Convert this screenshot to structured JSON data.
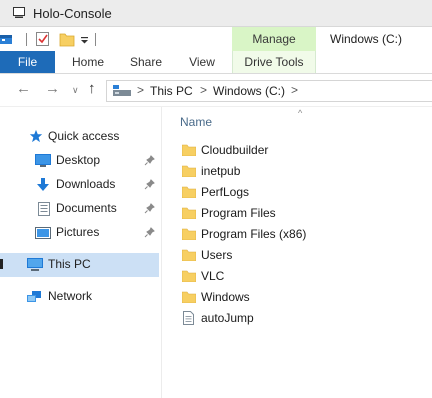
{
  "window": {
    "title": "Holo-Console"
  },
  "quick_access_toolbar": {
    "items": [
      "properties-icon",
      "checkmark-icon",
      "new-folder-icon",
      "customize-dropdown-icon"
    ]
  },
  "ribbon": {
    "contextual_group": "Manage",
    "location_title": "Windows (C:)",
    "tabs": [
      "File",
      "Home",
      "Share",
      "View",
      "Drive Tools"
    ]
  },
  "address_bar": {
    "crumbs": [
      "This PC",
      "Windows (C:)"
    ],
    "separator": ">"
  },
  "nav_pane": {
    "items": [
      {
        "label": "Quick access",
        "icon": "star-icon",
        "pinned": false
      },
      {
        "label": "Desktop",
        "icon": "desktop-icon",
        "pinned": true
      },
      {
        "label": "Downloads",
        "icon": "download-arrow-icon",
        "pinned": true
      },
      {
        "label": "Documents",
        "icon": "documents-icon",
        "pinned": true
      },
      {
        "label": "Pictures",
        "icon": "pictures-icon",
        "pinned": true
      },
      {
        "label": "This PC",
        "icon": "computer-icon",
        "selected": true
      },
      {
        "label": "Network",
        "icon": "network-icon"
      }
    ]
  },
  "content": {
    "column_header": "Name",
    "sort_indicator": "^",
    "files": [
      {
        "name": "Cloudbuilder",
        "type": "folder"
      },
      {
        "name": "inetpub",
        "type": "folder"
      },
      {
        "name": "PerfLogs",
        "type": "folder"
      },
      {
        "name": "Program Files",
        "type": "folder"
      },
      {
        "name": "Program Files (x86)",
        "type": "folder"
      },
      {
        "name": "Users",
        "type": "folder"
      },
      {
        "name": "VLC",
        "type": "folder"
      },
      {
        "name": "Windows",
        "type": "folder"
      },
      {
        "name": "autoJump",
        "type": "file"
      }
    ]
  },
  "colors": {
    "file_tab": "#1e6bb8",
    "manage_group": "#d9f5c6",
    "selection": "#cce0f5",
    "folder": "#f7cf62",
    "accent": "#1e79d6"
  }
}
